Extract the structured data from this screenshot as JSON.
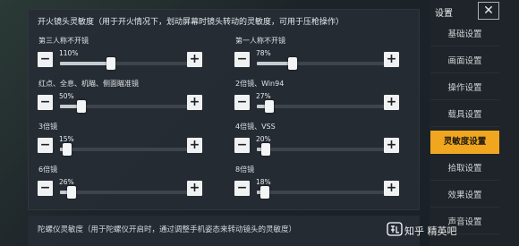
{
  "panel": {
    "title": "开火镜头灵敏度（用于开火情况下，划动屏幕时镜头转动的灵敏度，可用于压枪操作）",
    "title2": "陀螺仪灵敏度（用于陀螺仪开启时，通过调整手机姿态来转动镜头的灵敏度）"
  },
  "sliders": [
    {
      "label": "第三人称不开镜",
      "value": "110%",
      "level": 0.37
    },
    {
      "label": "第一人称不开镜",
      "value": "78%",
      "level": 0.26
    },
    {
      "label": "红点、全息、机瞄、侧面瞄准镜",
      "value": "50%",
      "level": 0.16
    },
    {
      "label": "2倍镜、Win94",
      "value": "27%",
      "level": 0.09
    },
    {
      "label": "3倍镜",
      "value": "15%",
      "level": 0.05
    },
    {
      "label": "4倍镜、VSS",
      "value": "20%",
      "level": 0.065
    },
    {
      "label": "6倍镜",
      "value": "26%",
      "level": 0.085
    },
    {
      "label": "8倍镜",
      "value": "18%",
      "level": 0.06
    }
  ],
  "controls": {
    "minus": "−",
    "plus": "+"
  },
  "menu": {
    "header": "设置",
    "close": "✕",
    "items": [
      "基础设置",
      "画面设置",
      "操作设置",
      "载具设置",
      "灵敏度设置",
      "拾取设置",
      "效果设置",
      "声音设置"
    ],
    "active_index": 4
  },
  "watermark": "知乎 精英吧",
  "colors": {
    "accent": "#f0a61f"
  }
}
